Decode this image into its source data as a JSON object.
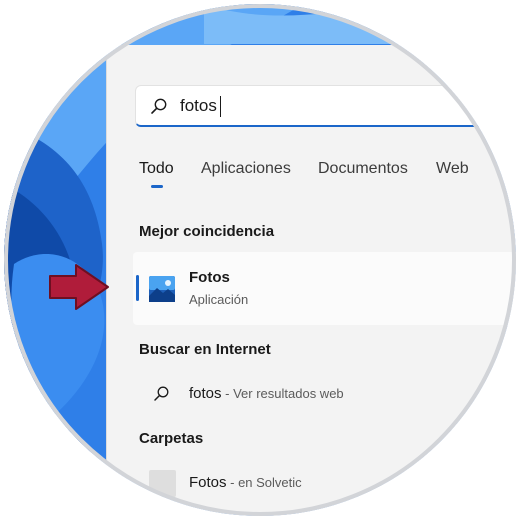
{
  "search": {
    "query": "fotos"
  },
  "tabs": [
    {
      "label": "Todo"
    },
    {
      "label": "Aplicaciones"
    },
    {
      "label": "Documentos"
    },
    {
      "label": "Web"
    }
  ],
  "sections": {
    "best_match": "Mejor coincidencia",
    "internet": "Buscar en Internet",
    "folders": "Carpetas"
  },
  "best_match": {
    "title": "Fotos",
    "subtitle": "Aplicación",
    "icon": "photos-app-icon"
  },
  "internet_result": {
    "query": "fotos",
    "suffix": " - Ver resultados web",
    "icon": "search-icon"
  },
  "folder_result": {
    "name": "Fotos",
    "location": " - en Solvetic",
    "icon": "folder-icon"
  },
  "colors": {
    "accent": "#1b66c9",
    "arrow": "#b01c3a",
    "panel": "#f3f3f3"
  }
}
